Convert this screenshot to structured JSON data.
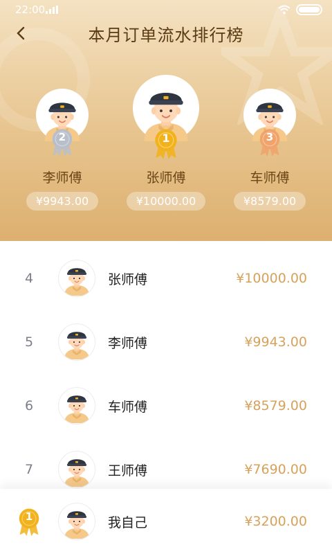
{
  "status_bar": {
    "time": "22:00"
  },
  "header": {
    "title": "本月订单流水排行榜"
  },
  "podium": {
    "first": {
      "rank": "1",
      "name": "张师傅",
      "amount": "¥10000.00"
    },
    "second": {
      "rank": "2",
      "name": "李师傅",
      "amount": "¥9943.00"
    },
    "third": {
      "rank": "3",
      "name": "车师傅",
      "amount": "¥8579.00"
    }
  },
  "list": [
    {
      "rank": "4",
      "name": "张师傅",
      "amount": "¥10000.00"
    },
    {
      "rank": "5",
      "name": "李师傅",
      "amount": "¥9943.00"
    },
    {
      "rank": "6",
      "name": "车师傅",
      "amount": "¥8579.00"
    },
    {
      "rank": "7",
      "name": "王师傅",
      "amount": "¥7690.00"
    }
  ],
  "self": {
    "rank": "1",
    "name": "我自己",
    "amount": "¥3200.00"
  },
  "colors": {
    "accent": "#d6a25b",
    "gold": "#f2b21b",
    "silver": "#b9bfca",
    "bronze": "#f0a36b",
    "skin": "#ffd9b8"
  },
  "icons": {
    "back": "chevron-left-icon",
    "wifi": "wifi-icon",
    "signal": "signal-icon",
    "battery": "battery-icon",
    "avatar": "driver-avatar-icon",
    "medal": "medal-icon"
  }
}
